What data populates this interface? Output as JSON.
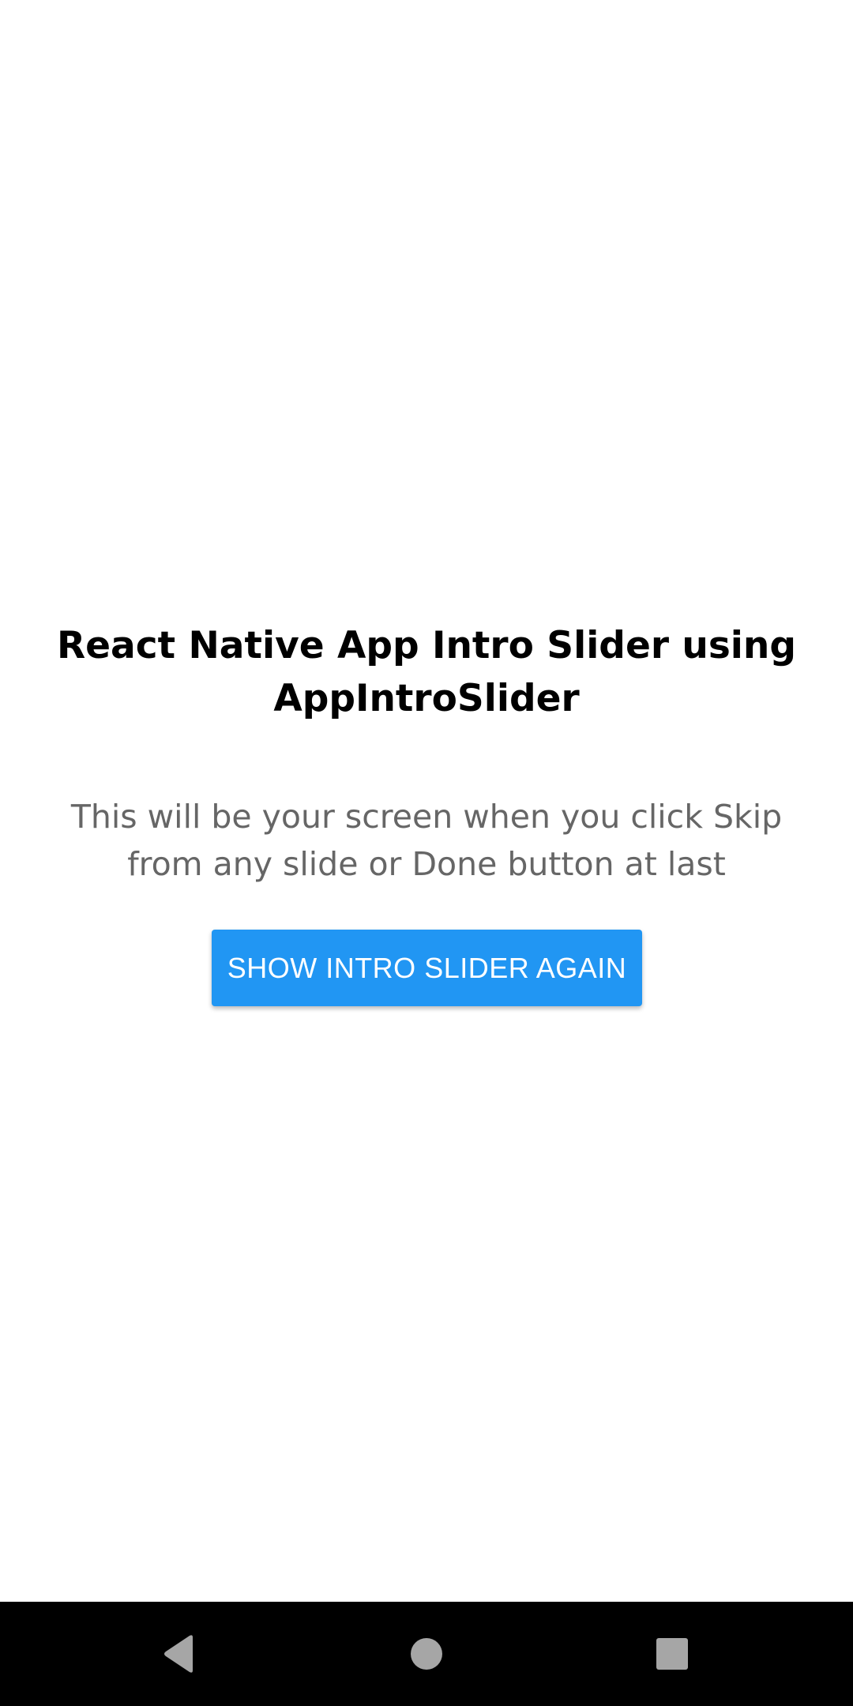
{
  "main": {
    "title": "React Native App Intro Slider using AppIntroSlider",
    "subtitle": "This will be your screen when you click Skip from any slide or Done button at last",
    "button_label": "SHOW INTRO SLIDER AGAIN"
  },
  "nav_bar": {
    "buttons": [
      {
        "name": "back",
        "icon": "back-triangle-icon"
      },
      {
        "name": "home",
        "icon": "home-circle-icon"
      },
      {
        "name": "recents",
        "icon": "recents-square-icon"
      }
    ]
  },
  "colors": {
    "background": "#ffffff",
    "title": "#000000",
    "subtitle": "#666666",
    "button_background": "#2196f3",
    "button_text": "#ffffff",
    "nav_bar_background": "#000000",
    "nav_icons": "#a6a6a6"
  }
}
